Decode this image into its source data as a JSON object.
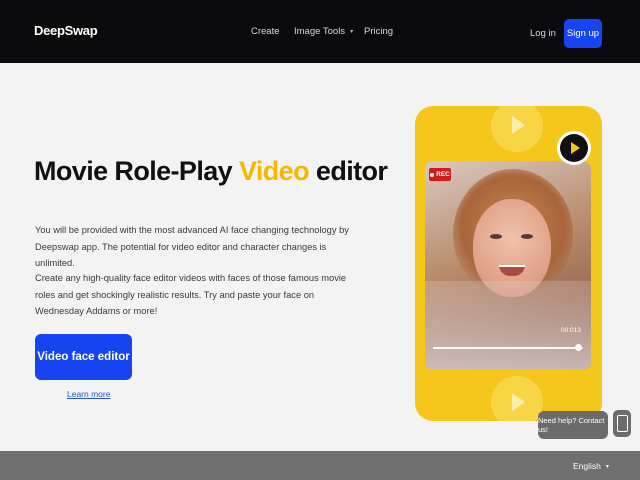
{
  "header": {
    "logo": "DeepSwap",
    "nav": {
      "create": "Create",
      "image_tools": "Image Tools",
      "pricing": "Pricing"
    },
    "login": "Log in",
    "signup": "Sign up"
  },
  "hero": {
    "title_before": "Movie Role-Play ",
    "title_accent": "Video",
    "title_after": " editor",
    "paragraph_1": "You will be provided with the most advanced AI face changing technology by Deepswap app. The potential for video editor and character changes is unlimited.",
    "paragraph_2": "Create any high-quality face editor videos with faces of those famous movie roles and get shockingly realistic results. Try and paste your face on Wednesday Addams or more!",
    "cta": "Video face editor",
    "learn_more": "Learn more"
  },
  "video_card": {
    "rec_label": "REC",
    "timecode": "00:013",
    "progress": 0.97
  },
  "help": {
    "label": "Need help? Contact us!"
  },
  "footer": {
    "language": "English"
  },
  "colors": {
    "accent_yellow": "#f5b800",
    "brand_blue": "#1544f0",
    "card_yellow": "#f5c71a",
    "header_bg": "#0b0b0d",
    "footer_bg": "#6f6f70"
  },
  "icons": {
    "dropdown": "chevron-down-icon",
    "play": "play-icon",
    "rec": "record-dot-icon",
    "phone": "phone-icon"
  }
}
